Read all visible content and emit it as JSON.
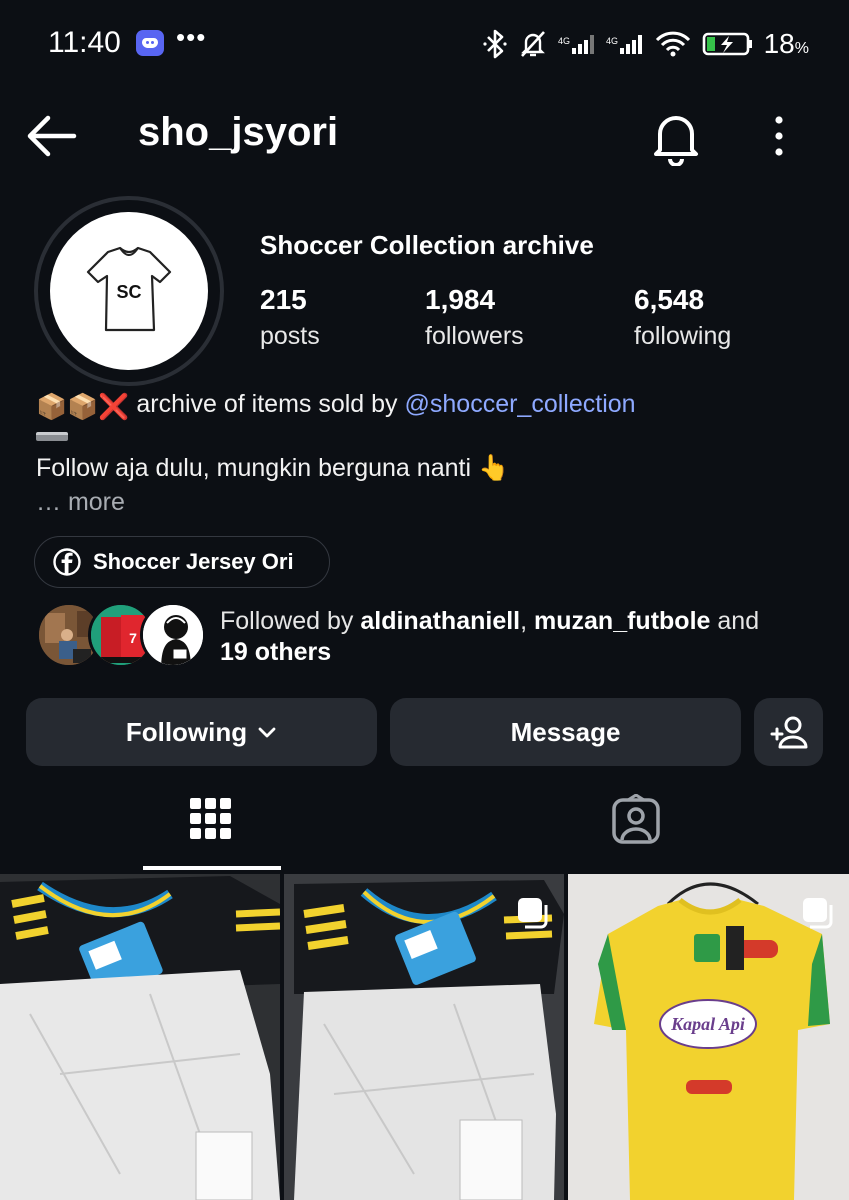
{
  "status_bar": {
    "time": "11:40",
    "dots": "•••",
    "battery_percent": "18",
    "battery_unit": "%",
    "icons": [
      "discord-icon",
      "bluetooth-icon",
      "mute-bell-icon",
      "signal-icon",
      "signal-icon",
      "wifi-icon",
      "battery-charging-icon"
    ]
  },
  "header": {
    "username": "sho_jsyori",
    "icons": [
      "back-arrow-icon",
      "bell-icon",
      "more-vertical-icon"
    ]
  },
  "profile": {
    "avatar_text": "SC",
    "display_name": "Shoccer Collection archive",
    "stats": [
      {
        "value": "215",
        "label": "posts"
      },
      {
        "value": "1,984",
        "label": "followers"
      },
      {
        "value": "6,548",
        "label": "following"
      }
    ],
    "bio_emojis": "📦📦❌",
    "bio_line1": " archive of items sold by ",
    "bio_mention": "@shoccer_collection",
    "bio_line2": "Follow aja dulu, mungkin berguna nanti ",
    "bio_line2_emoji": "👆",
    "more": "… more",
    "link_chip": "Shoccer Jersey Ori",
    "followed_by_prefix": "Followed by ",
    "followed_by_user1": "aldinathaniell",
    "followed_by_sep": ", ",
    "followed_by_user2": "muzan_futbole",
    "followed_by_and": " and",
    "followed_by_others": "19 others"
  },
  "actions": {
    "following": "Following",
    "message": "Message"
  },
  "colors": {
    "background": "#0c0f14",
    "button": "#262a31",
    "mention": "#8ea9ff",
    "jersey_yellow": "#f2d22e"
  }
}
